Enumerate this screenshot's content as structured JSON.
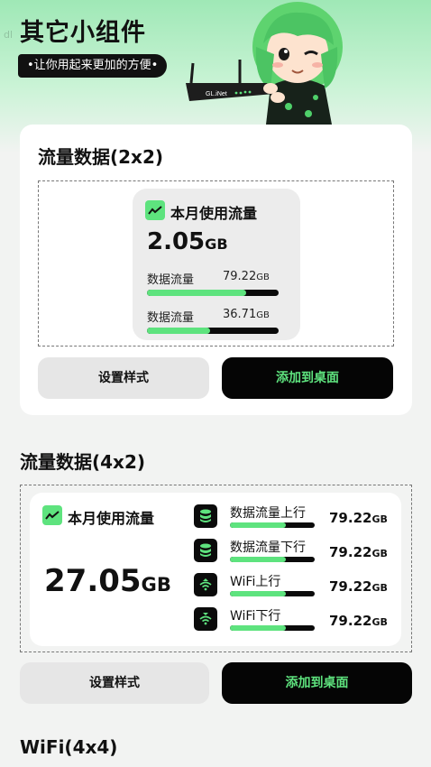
{
  "header": {
    "title": "其它小组件",
    "subtitle": "•让你用起来更加的方便•",
    "watermark": "dl",
    "router_brand": "GL.iNet"
  },
  "widget_2x2": {
    "section_title": "流量数据(2x2)",
    "card_title": "本月使用流量",
    "total_value": "2.05",
    "total_unit": "GB",
    "rows": [
      {
        "label": "数据流量",
        "value": "79.22",
        "unit": "GB",
        "progress": 0.75
      },
      {
        "label": "数据流量",
        "value": "36.71",
        "unit": "GB",
        "progress": 0.48
      }
    ],
    "style_button": "设置样式",
    "add_button": "添加到桌面"
  },
  "widget_4x2": {
    "section_title": "流量数据(4x2)",
    "card_title": "本月使用流量",
    "total_value": "27.05",
    "total_unit": "GB",
    "rows": [
      {
        "label": "数据流量上行",
        "value": "79.22",
        "unit": "GB",
        "icon": "database-icon",
        "progress": 0.66
      },
      {
        "label": "数据流量下行",
        "value": "79.22",
        "unit": "GB",
        "icon": "database-icon",
        "progress": 0.66
      },
      {
        "label": "WiFi上行",
        "value": "79.22",
        "unit": "GB",
        "icon": "wifi-up-icon",
        "progress": 0.66
      },
      {
        "label": "WiFi下行",
        "value": "79.22",
        "unit": "GB",
        "icon": "wifi-down-icon",
        "progress": 0.66
      }
    ],
    "style_button": "设置样式",
    "add_button": "添加到桌面"
  },
  "widget_4x4": {
    "section_title": "WiFi(4x4)"
  },
  "colors": {
    "accent_green": "#5ee37e",
    "hero_green": "#9fe8b6",
    "bar_track": "#0b0b0b"
  }
}
